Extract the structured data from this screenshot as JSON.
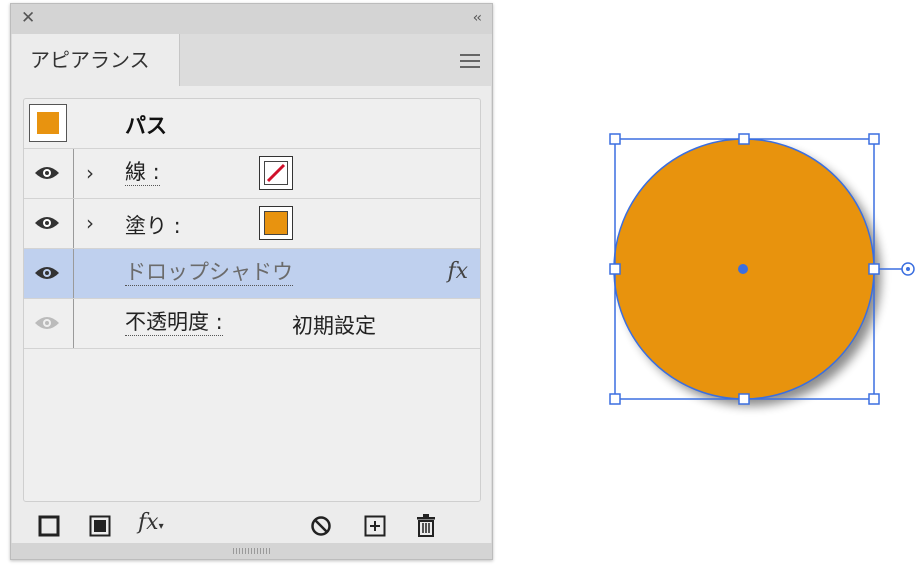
{
  "panel": {
    "tab_label": "アピアランス",
    "header": {
      "title": "パス"
    },
    "rows": [
      {
        "label": "線 :"
      },
      {
        "label": "塗り :"
      },
      {
        "label": "ドロップシャドウ",
        "fx": "fx"
      },
      {
        "label": "不透明度 :",
        "value": "初期設定"
      }
    ],
    "footer": {
      "fx_label": "fx"
    }
  },
  "colors": {
    "fill": "#e8930f",
    "selection": "#bfd0ee",
    "bbox": "#3b6fe0"
  },
  "icons": [
    "close-icon",
    "collapse-icon",
    "panel-menu-icon",
    "eye-icon",
    "chevron-right-icon",
    "add-new-stroke-icon",
    "add-new-fill-icon",
    "add-effect-icon",
    "clear-appearance-icon",
    "duplicate-item-icon",
    "delete-icon"
  ]
}
